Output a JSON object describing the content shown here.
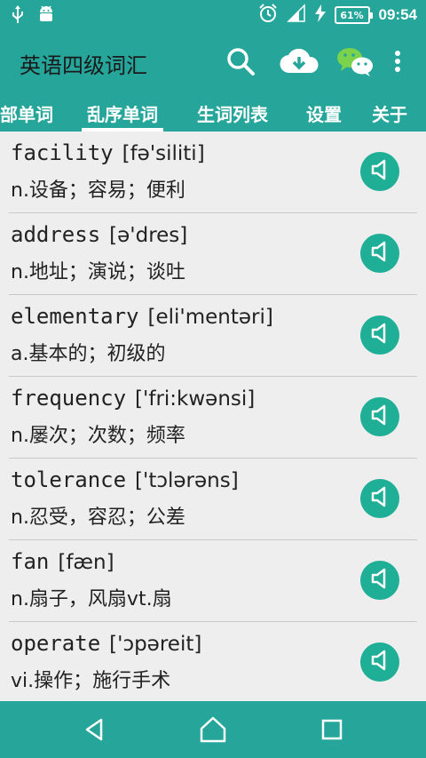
{
  "status": {
    "battery": "61%",
    "time": "09:54"
  },
  "appbar": {
    "title": "英语四级词汇"
  },
  "tabs": [
    {
      "label": "部单词",
      "active": false
    },
    {
      "label": "乱序单词",
      "active": true
    },
    {
      "label": "生词列表",
      "active": false
    },
    {
      "label": "设置",
      "active": false
    },
    {
      "label": "关于",
      "active": false
    }
  ],
  "words": [
    {
      "word": "facility",
      "phonetic": "[fə'siliti]",
      "meaning": "n.设备；容易；便利"
    },
    {
      "word": "address",
      "phonetic": "[ə'dres]",
      "meaning": "n.地址；演说；谈吐"
    },
    {
      "word": "elementary",
      "phonetic": "[eli'mentəri]",
      "meaning": "a.基本的；初级的"
    },
    {
      "word": "frequency",
      "phonetic": "['fri:kwənsi]",
      "meaning": "n.屡次；次数；频率"
    },
    {
      "word": "tolerance",
      "phonetic": "['tɔlərəns]",
      "meaning": "n.忍受，容忍；公差"
    },
    {
      "word": "fan",
      "phonetic": "[fæn]",
      "meaning": "n.扇子，风扇vt.扇"
    },
    {
      "word": "operate",
      "phonetic": "['ɔpəreit]",
      "meaning": "vi.操作；施行手术"
    }
  ],
  "colors": {
    "primary": "#26A69A",
    "speak_button": "#1FAE96",
    "background": "#EEEEEE"
  },
  "icons": {
    "usb": "usb-icon",
    "android": "android-icon",
    "alarm": "alarm-icon",
    "signal": "signal-icon",
    "charging": "bolt-icon",
    "search": "search-icon",
    "download": "cloud-download-icon",
    "wechat": "wechat-icon",
    "more": "more-vert-icon",
    "speaker": "speaker-icon",
    "back": "back-icon",
    "home": "home-icon",
    "recents": "recents-icon"
  }
}
